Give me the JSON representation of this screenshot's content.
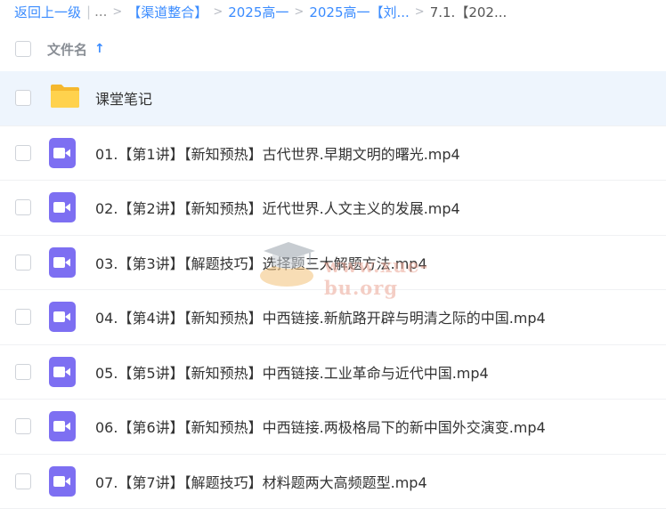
{
  "breadcrumb": {
    "back": "返回上一级",
    "ellipsis": "...",
    "items": [
      "【渠道整合】",
      "2025高一",
      "2025高一【刘...",
      "7.1.【202..."
    ]
  },
  "header": {
    "name_column": "文件名"
  },
  "files": [
    {
      "name": "课堂笔记",
      "type": "folder"
    },
    {
      "name": "01.【第1讲】【新知预热】古代世界.早期文明的曙光.mp4",
      "type": "video"
    },
    {
      "name": "02.【第2讲】【新知预热】近代世界.人文主义的发展.mp4",
      "type": "video"
    },
    {
      "name": "03.【第3讲】【解题技巧】选择题三大解题方法.mp4",
      "type": "video"
    },
    {
      "name": "04.【第4讲】【新知预热】中西链接.新航路开辟与明清之际的中国.mp4",
      "type": "video"
    },
    {
      "name": "05.【第5讲】【新知预热】中西链接.工业革命与近代中国.mp4",
      "type": "video"
    },
    {
      "name": "06.【第6讲】【新知预热】中西链接.两极格局下的新中国外交演变.mp4",
      "type": "video"
    },
    {
      "name": "07.【第7讲】【解题技巧】材料题两大高频题型.mp4",
      "type": "video"
    }
  ],
  "watermark": {
    "text": "www.xue-bu.org"
  },
  "colors": {
    "accent": "#3b8cff",
    "video_icon": "#7d6ff2",
    "folder": "#ffd24d",
    "selected_row": "#eef5fd"
  }
}
